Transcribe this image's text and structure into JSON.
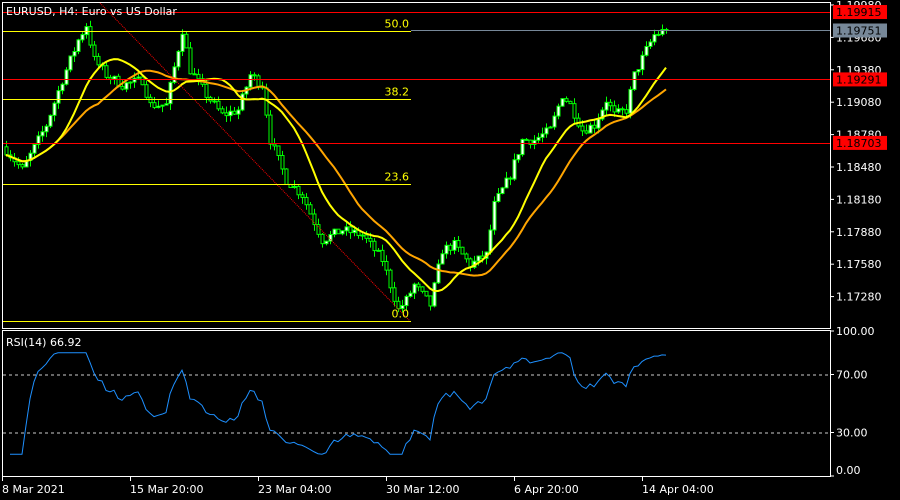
{
  "chart_title": "EURUSD, H4:  Euro vs US Dollar",
  "colors": {
    "background": "#000000",
    "frame": "#ffffff",
    "candle": "#00ff00",
    "bull_body": "#ffffff",
    "bear_body": "#000000",
    "ma_fast": "#ffff00",
    "ma_slow": "#ffa500",
    "hline": "#ff0000",
    "current_price": "#778899",
    "fib": "#ffff00",
    "fib_trend": "#ff0000",
    "rsi": "#1e90ff"
  },
  "price_axis": {
    "ticks": [
      "1.19980",
      "1.19680",
      "1.19380",
      "1.19080",
      "1.18780",
      "1.18480",
      "1.18180",
      "1.17880",
      "1.17580",
      "1.17280"
    ],
    "range": [
      1.1698,
      1.2003
    ]
  },
  "horizontal_lines": [
    {
      "price": 1.19915,
      "label": "1.19915"
    },
    {
      "price": 1.19291,
      "label": "1.19291"
    },
    {
      "price": 1.18703,
      "label": "1.18703"
    }
  ],
  "current_price": {
    "price": 1.19751,
    "label": "1.19751"
  },
  "fibonacci": [
    {
      "level": "50.0",
      "price": 1.19739
    },
    {
      "level": "38.2",
      "price": 1.1911
    },
    {
      "level": "23.6",
      "price": 1.18322
    },
    {
      "level": "0.0",
      "price": 1.17054
    }
  ],
  "time_axis": [
    "8 Mar 2021",
    "15 Mar 20:00",
    "23 Mar 04:00",
    "30 Mar 12:00",
    "6 Apr 20:00",
    "14 Apr 04:00"
  ],
  "price_path": [
    [
      0,
      1.18637
    ],
    [
      4,
      1.18452
    ],
    [
      10,
      1.18869
    ],
    [
      14,
      1.19286
    ],
    [
      18,
      1.19656
    ],
    [
      20,
      1.19795
    ],
    [
      22,
      1.19471
    ],
    [
      25,
      1.19332
    ],
    [
      29,
      1.19239
    ],
    [
      34,
      1.19286
    ],
    [
      36,
      1.19054
    ],
    [
      40,
      1.19054
    ],
    [
      44,
      1.19749
    ],
    [
      46,
      1.19378
    ],
    [
      50,
      1.19147
    ],
    [
      54,
      1.18961
    ],
    [
      58,
      1.19008
    ],
    [
      61,
      1.19332
    ],
    [
      64,
      1.19239
    ],
    [
      66,
      1.1873
    ],
    [
      70,
      1.1836
    ],
    [
      74,
      1.18221
    ],
    [
      79,
      1.17804
    ],
    [
      84,
      1.17897
    ],
    [
      89,
      1.1785
    ],
    [
      94,
      1.17619
    ],
    [
      98,
      1.17156
    ],
    [
      100,
      1.17248
    ],
    [
      102,
      1.17387
    ],
    [
      106,
      1.17202
    ],
    [
      109,
      1.17711
    ],
    [
      112,
      1.17758
    ],
    [
      116,
      1.17573
    ],
    [
      120,
      1.17665
    ],
    [
      122,
      1.18128
    ],
    [
      126,
      1.18406
    ],
    [
      129,
      1.1873
    ],
    [
      132,
      1.1873
    ],
    [
      136,
      1.18823
    ],
    [
      139,
      1.19147
    ],
    [
      141,
      1.19054
    ],
    [
      144,
      1.18823
    ],
    [
      147,
      1.18869
    ],
    [
      150,
      1.19101
    ],
    [
      152,
      1.18961
    ],
    [
      155,
      1.19008
    ],
    [
      157,
      1.19332
    ],
    [
      160,
      1.19563
    ],
    [
      162,
      1.19702
    ],
    [
      165,
      1.19751
    ]
  ],
  "ma_periods": {
    "fast": 14,
    "slow": 24
  },
  "rsi": {
    "label": "RSI(14) 66.92",
    "period": 14,
    "levels": [
      70,
      30
    ],
    "ticks": [
      "100.00",
      "70.00",
      "30.00",
      "0.00"
    ]
  }
}
